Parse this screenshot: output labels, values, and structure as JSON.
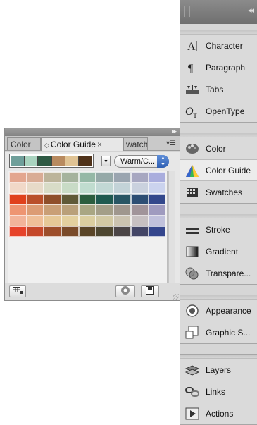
{
  "dock": {
    "groups": [
      {
        "items": [
          {
            "label": "Character",
            "icon": "character-icon"
          },
          {
            "label": "Paragraph",
            "icon": "paragraph-icon"
          },
          {
            "label": "Tabs",
            "icon": "tabs-icon"
          },
          {
            "label": "OpenType",
            "icon": "opentype-icon"
          }
        ]
      },
      {
        "items": [
          {
            "label": "Color",
            "icon": "color-icon"
          },
          {
            "label": "Color Guide",
            "icon": "color-guide-icon",
            "active": true
          },
          {
            "label": "Swatches",
            "icon": "swatches-icon"
          }
        ]
      },
      {
        "items": [
          {
            "label": "Stroke",
            "icon": "stroke-icon"
          },
          {
            "label": "Gradient",
            "icon": "gradient-icon"
          },
          {
            "label": "Transpare...",
            "icon": "transparency-icon"
          }
        ]
      },
      {
        "items": [
          {
            "label": "Appearance",
            "icon": "appearance-icon"
          },
          {
            "label": "Graphic S...",
            "icon": "graphic-styles-icon"
          }
        ]
      },
      {
        "items": [
          {
            "label": "Layers",
            "icon": "layers-icon"
          },
          {
            "label": "Links",
            "icon": "links-icon"
          },
          {
            "label": "Actions",
            "icon": "actions-icon"
          }
        ]
      }
    ]
  },
  "panel": {
    "tabs": [
      {
        "label": "Color"
      },
      {
        "label": "Color Guide",
        "close": "×"
      },
      {
        "label": "watches"
      }
    ],
    "rules_value": "Warm/C...",
    "base_colors": [
      "#6f9f9a",
      "#a9d3bf",
      "#2f5a44",
      "#b88a5f",
      "#e0c394",
      "#4f3219"
    ],
    "grid_colors": [
      [
        "#e3a68f",
        "#d9ac95",
        "#bcb49a",
        "#a5b39d",
        "#95b8a6",
        "#95a9a8",
        "#9aa5b0",
        "#a7a7c1",
        "#a9addd"
      ],
      [
        "#f1d8c8",
        "#e7dac8",
        "#d8dcc7",
        "#c8dbc6",
        "#c0dccf",
        "#c2d8d5",
        "#c3d3d8",
        "#cad1de",
        "#cbd3ee"
      ],
      [
        "#e0401c",
        "#b94f2a",
        "#8f4f2a",
        "#5f5937",
        "#2b5d3e",
        "#1f5a50",
        "#285664",
        "#2d4e74",
        "#33488c"
      ],
      [
        "#ee9572",
        "#dc9c74",
        "#c99f76",
        "#b9a07a",
        "#a9a683",
        "#a39e88",
        "#9f978e",
        "#a1949a",
        "#9f9bbf"
      ],
      [
        "#f2b49a",
        "#efbf98",
        "#e6c897",
        "#e3d09f",
        "#dbcea0",
        "#d2c9a4",
        "#cbc3b0",
        "#c7c0c2",
        "#c0c1dc"
      ],
      [
        "#e6432a",
        "#c5482a",
        "#9d4e2b",
        "#7a4b2a",
        "#5a4527",
        "#4d4630",
        "#4b4546",
        "#434566",
        "#34468d"
      ]
    ]
  }
}
